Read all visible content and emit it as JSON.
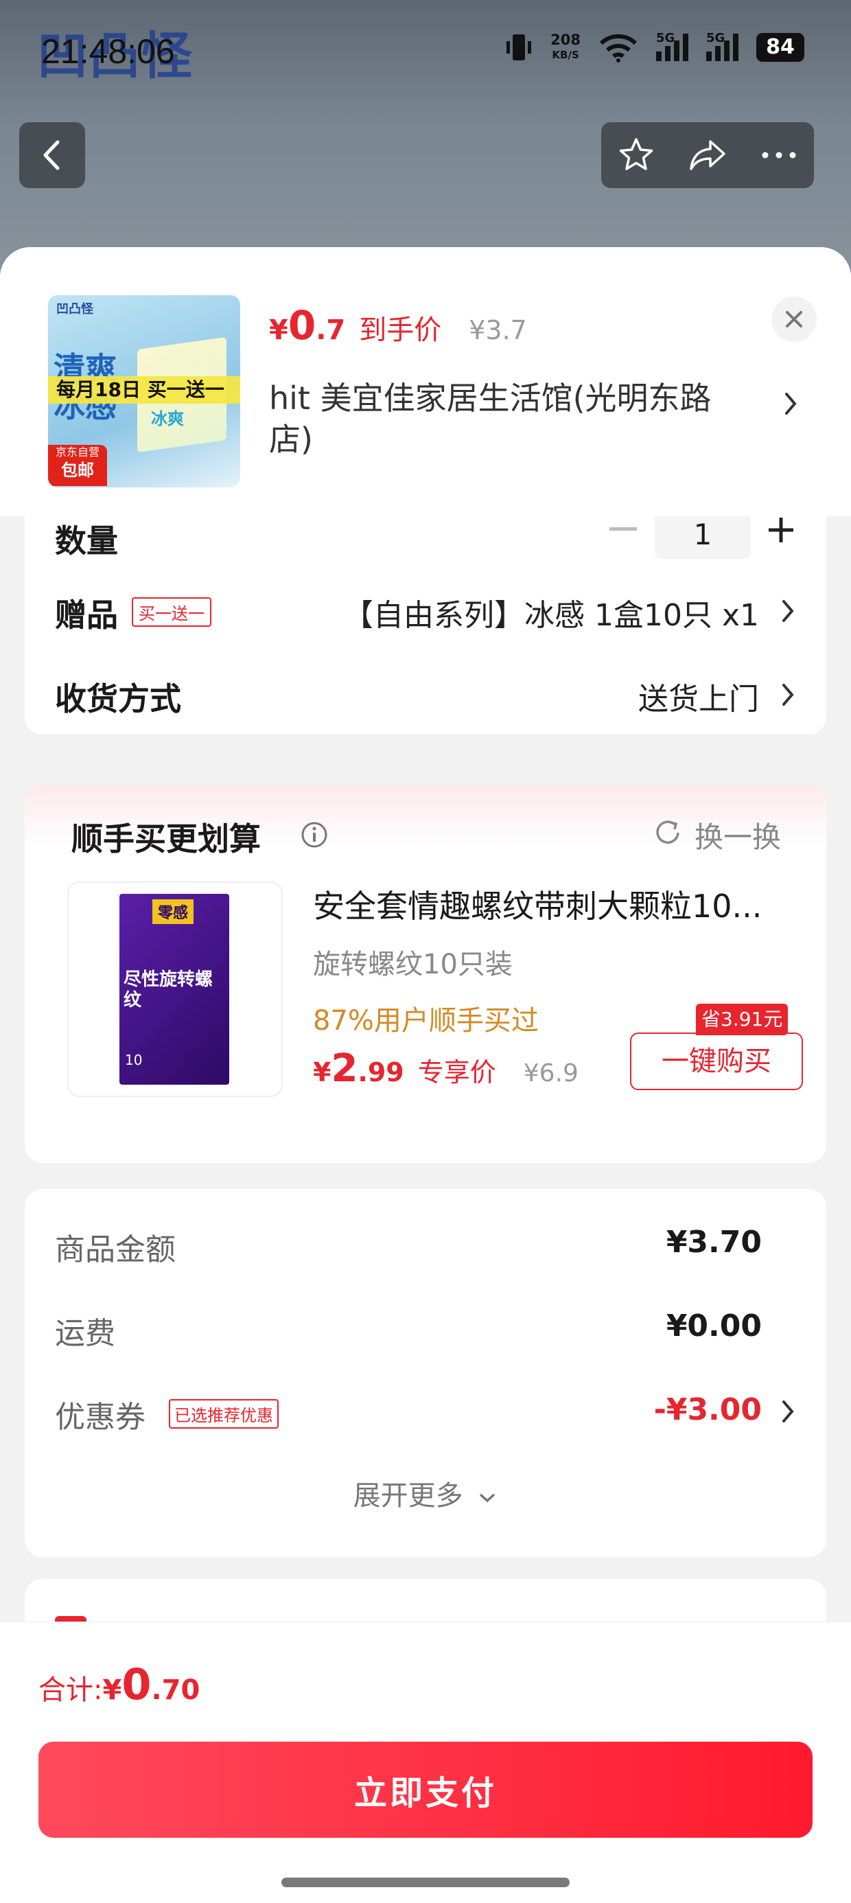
{
  "status_bar": {
    "time": "21:48:06",
    "speed_value": "208",
    "speed_unit": "KB/S",
    "net1": "5G",
    "net2": "5G",
    "battery": "84"
  },
  "background": {
    "brand": "凹凸怪"
  },
  "product": {
    "thumb_brand": "凹凸怪",
    "thumb_promo": "每月18日 买一送一",
    "thumb_line1": "清爽",
    "thumb_line2": "冰感",
    "thumb_box": "冰爽",
    "thumb_tag1": "京东自营",
    "thumb_tag2": "包邮",
    "price_symbol": "¥",
    "price_int": "0",
    "price_dec": ".7",
    "price_label": "到手价",
    "original_price": "¥3.7",
    "shop_name": "hit  美宜佳家居生活馆(光明东路店)"
  },
  "options": {
    "quantity_label": "数量",
    "quantity": "1",
    "gift_label": "赠品",
    "gift_badge": "买一送一",
    "gift_value": "【自由系列】冰感 1盒10只 x1",
    "delivery_label": "收货方式",
    "delivery_value": "送货上门"
  },
  "bundle": {
    "title": "顺手买更划算",
    "refresh_label": "换一换",
    "item_name": "安全套情趣螺纹带刺大颗粒10...",
    "item_spec": "旋转螺纹10只装",
    "item_stat": "87%用户顺手买过",
    "price_symbol": "¥",
    "price_int": "2",
    "price_dec": ".99",
    "price_label": "专享价",
    "original_price": "¥6.9",
    "save_badge": "省3.91元",
    "buy_button": "一键购买",
    "box_brand": "零感",
    "box_big": "尽性旋转螺纹",
    "box_count": "10"
  },
  "summary": {
    "goods_label": "商品金额",
    "goods_value": "¥3.70",
    "shipping_label": "运费",
    "shipping_value": "¥0.00",
    "coupon_label": "优惠券",
    "coupon_badge": "已选推荐优惠",
    "coupon_value": "-¥3.00",
    "expand_label": "展开更多"
  },
  "footer": {
    "total_label": "合计: ",
    "total_symbol": "¥",
    "total_int": "0",
    "total_dec": ".70",
    "pay_button": "立即支付"
  },
  "colors": {
    "accent": "#e7252f",
    "pay_button": "#ff2a3c",
    "orange_text": "#d38a24"
  }
}
